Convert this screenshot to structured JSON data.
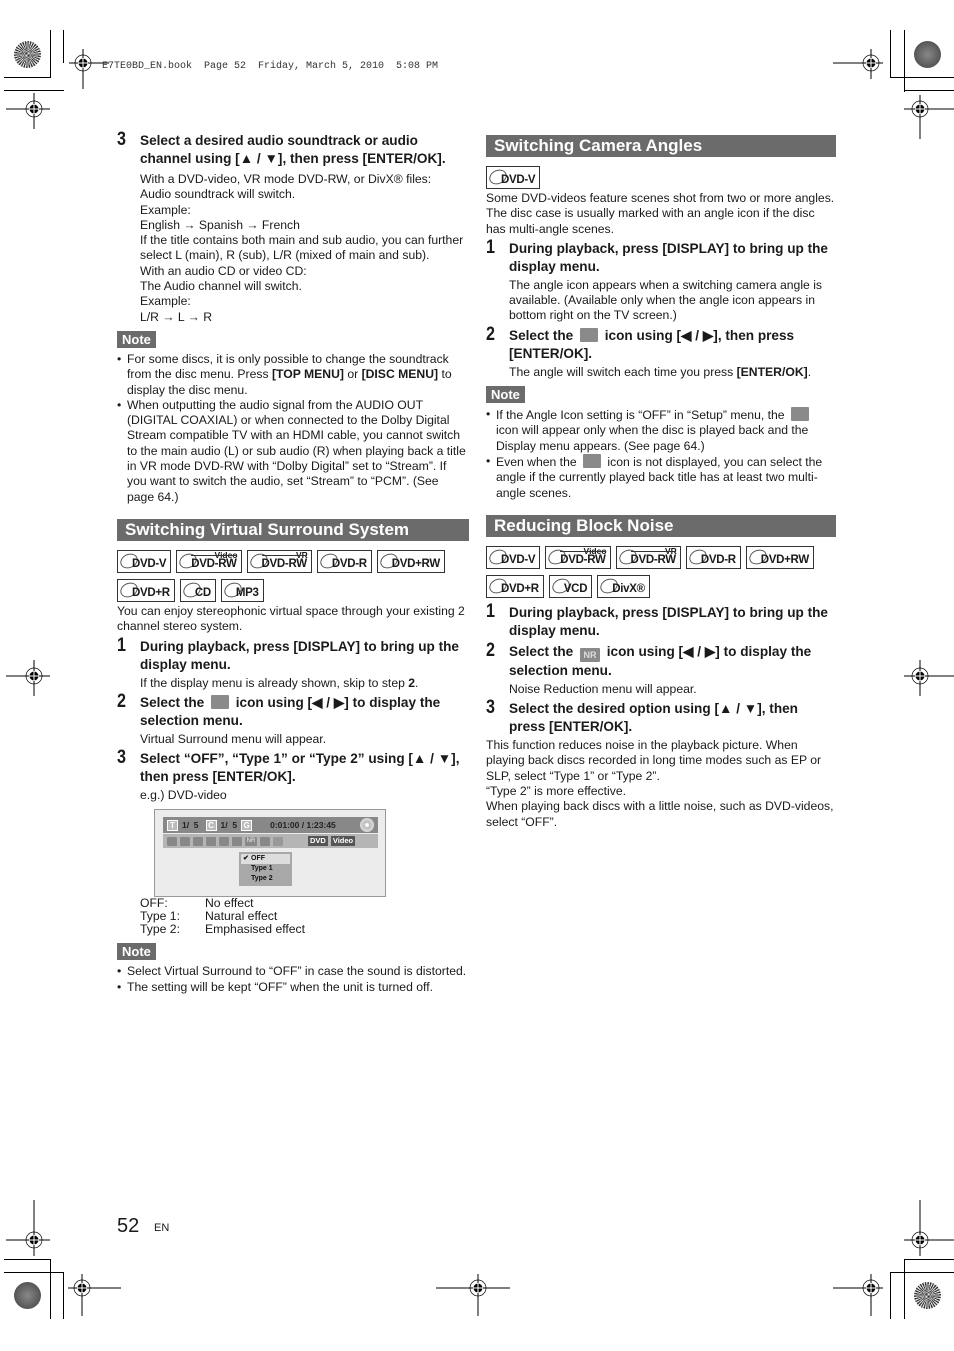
{
  "print_header": "E7TE0BD_EN.book  Page 52  Friday, March 5, 2010  5:08 PM",
  "left": {
    "intro_step": {
      "num": "3",
      "title": "Select a desired audio soundtrack or audio channel using [▲ / ▼], then press [ENTER/OK].",
      "body": [
        "With a DVD-video, VR mode DVD-RW, or DivX® files:",
        "Audio soundtrack will switch.",
        "Example:",
        "English → Spanish → French",
        "If the title contains both main and sub audio, you can further select L (main), R (sub), L/R (mixed of main and sub).",
        "With an audio CD or video CD:",
        "The Audio channel will switch.",
        "Example:",
        "L/R → L → R"
      ]
    },
    "note1": {
      "label": "Note",
      "items": [
        {
          "pre": "For some discs, it is only possible to change the soundtrack from the disc menu. Press ",
          "b1": "[TOP MENU]",
          "mid": " or ",
          "b2": "[DISC MENU]",
          "post": " to display the disc menu."
        },
        {
          "text": "When outputting the audio signal from the AUDIO OUT (DIGITAL COAXIAL) or when connected to the Dolby Digital Stream compatible TV with an HDMI cable, you cannot switch to the main audio (L) or sub audio (R) when playing back a title in VR mode DVD-RW with “Dolby Digital” set to “Stream”. If you want to switch the audio, set “Stream” to “PCM”. (See page 64.)"
        }
      ]
    },
    "surround": {
      "title": "Switching Virtual Surround System",
      "badges": [
        {
          "label": "DVD-V",
          "sup": ""
        },
        {
          "label": "DVD-RW",
          "sup": "Video"
        },
        {
          "label": "DVD-RW",
          "sup": "VR"
        },
        {
          "label": "DVD-R",
          "sup": ""
        },
        {
          "label": "DVD+RW",
          "sup": ""
        },
        {
          "label": "DVD+R",
          "sup": ""
        },
        {
          "label": "CD",
          "sup": ""
        },
        {
          "label": "MP3",
          "sup": ""
        }
      ],
      "intro": "You can enjoy stereophonic virtual space through your existing 2 channel stereo system.",
      "steps": [
        {
          "num": "1",
          "title": "During playback, press [DISPLAY] to bring up the display menu.",
          "body_pre": "If the display menu is already shown, skip to step ",
          "body_bold": "2",
          "body_post": "."
        },
        {
          "num": "2",
          "title_pre": "Select the ",
          "icon": "virtual-surround-icon",
          "title_post": " icon using [◀ / ▶] to display the selection menu.",
          "body": "Virtual Surround menu will appear."
        },
        {
          "num": "3",
          "title": "Select “OFF”, “Type 1” or “Type 2” using [▲ / ▼], then press [ENTER/OK].",
          "body": "e.g.) DVD-video"
        }
      ],
      "screen": {
        "title_label": "T",
        "title_value": "1/  5",
        "chapter_label": "C",
        "chapter_value": "1/  5",
        "time_label": "G",
        "time": "0:01:00 / 1:23:45",
        "icons": [
          "search-icon",
          "audio-icon",
          "subtitle-icon",
          "angle-icon",
          "repeat-icon",
          "marker-icon",
          "noise-reduction-icon",
          "zoom-icon",
          "virtual-surround-icon"
        ],
        "nr_label": "NR",
        "tags": [
          "DVD",
          "Video"
        ],
        "menu": [
          {
            "label": "OFF",
            "selected": true
          },
          {
            "label": "Type 1",
            "selected": false
          },
          {
            "label": "Type 2",
            "selected": false
          }
        ],
        "check": "✔"
      },
      "definitions": [
        {
          "k": "OFF:",
          "v": "No effect"
        },
        {
          "k": "Type 1:",
          "v": "Natural effect"
        },
        {
          "k": "Type 2:",
          "v": "Emphasised effect"
        }
      ],
      "note": {
        "label": "Note",
        "items": [
          "Select Virtual Surround to “OFF” in case the sound is distorted.",
          "The setting will be kept “OFF” when the unit is turned off."
        ]
      }
    }
  },
  "right": {
    "angles": {
      "title": "Switching Camera Angles",
      "badges": [
        {
          "label": "DVD-V",
          "sup": ""
        }
      ],
      "intro": "Some DVD-videos feature scenes shot from two or more angles. The disc case is usually marked with an angle icon if the disc has multi-angle scenes.",
      "steps": [
        {
          "num": "1",
          "title": "During playback, press [DISPLAY] to bring up the display menu.",
          "body": "The angle icon appears when a switching camera angle is available. (Available only when the angle icon appears in bottom right on the TV screen.)"
        },
        {
          "num": "2",
          "title_pre": "Select the ",
          "icon": "angle-icon",
          "title_post": " icon using [◀ / ▶], then press [ENTER/OK].",
          "body_pre": "The angle will switch each time you press ",
          "body_bold": "[ENTER/OK]",
          "body_post": "."
        }
      ],
      "note": {
        "label": "Note",
        "items": [
          {
            "pre": "If the Angle Icon setting is “OFF” in “Setup” menu, the ",
            "post": " icon will appear only when the disc is played back and the Display menu appears. (See page 64.)"
          },
          {
            "pre": "Even when the ",
            "post": " icon is not displayed, you can select the angle if the currently played back title has at least two multi-angle scenes."
          }
        ]
      }
    },
    "noise": {
      "title": "Reducing Block Noise",
      "badges": [
        {
          "label": "DVD-V",
          "sup": ""
        },
        {
          "label": "DVD-RW",
          "sup": "Video"
        },
        {
          "label": "DVD-RW",
          "sup": "VR"
        },
        {
          "label": "DVD-R",
          "sup": ""
        },
        {
          "label": "DVD+RW",
          "sup": ""
        },
        {
          "label": "DVD+R",
          "sup": ""
        },
        {
          "label": "VCD",
          "sup": ""
        },
        {
          "label": "DivX",
          "sup": "®"
        }
      ],
      "steps": [
        {
          "num": "1",
          "title": "During playback, press [DISPLAY] to bring up the display menu."
        },
        {
          "num": "2",
          "title_pre": "Select the ",
          "icon_label": "NR",
          "title_post": " icon using [◀ / ▶] to display the selection menu.",
          "body": "Noise Reduction menu will appear."
        },
        {
          "num": "3",
          "title": "Select the desired option using [▲ / ▼], then press [ENTER/OK]."
        }
      ],
      "outro": [
        "This function reduces noise in the playback picture. When playing back discs recorded in long time modes such as EP or SLP, select “Type 1” or “Type 2”.",
        "“Type 2” is more effective.",
        "When playing back discs with a little noise, such as DVD-videos, select “OFF”."
      ]
    }
  },
  "footer": {
    "page_number": "52",
    "language": "EN"
  }
}
